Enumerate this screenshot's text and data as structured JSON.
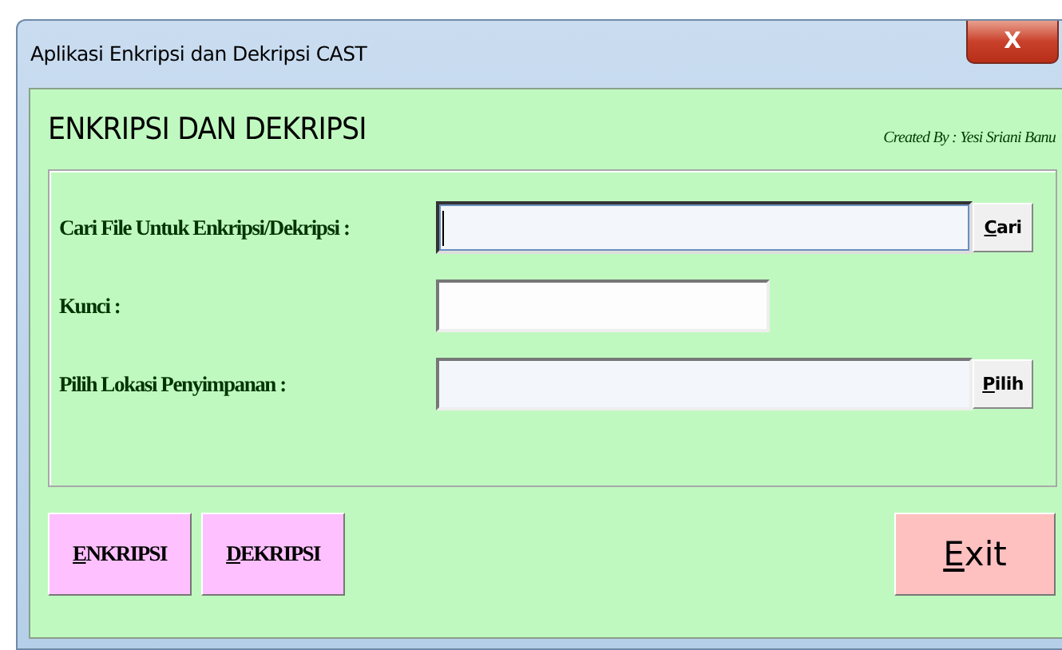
{
  "window": {
    "title": "Aplikasi Enkripsi dan Dekripsi CAST",
    "close_label": "X"
  },
  "header": {
    "title": "ENKRIPSI DAN DEKRIPSI",
    "credit": "Created By : Yesi Sriani Banu"
  },
  "fields": [
    {
      "label": "Cari File Untuk Enkripsi/Dekripsi :",
      "kind": "browse",
      "button": "Cari",
      "access_key_underlined": true,
      "focused": true
    },
    {
      "label": "Kunci :",
      "kind": "text",
      "focused": false
    },
    {
      "label": "Pilih Lokasi Penyimpanan :",
      "kind": "browse",
      "button": "Pilih",
      "access_key_underlined": true,
      "focused": false
    }
  ],
  "actions": [
    {
      "label": "ENKRIPSI",
      "kind": "action",
      "access_key_underlined": true
    },
    {
      "label": "DEKRIPSI",
      "kind": "action",
      "access_key_underlined": true
    },
    {
      "label": "Exit",
      "kind": "exit",
      "access_key_underlined": true
    }
  ]
}
